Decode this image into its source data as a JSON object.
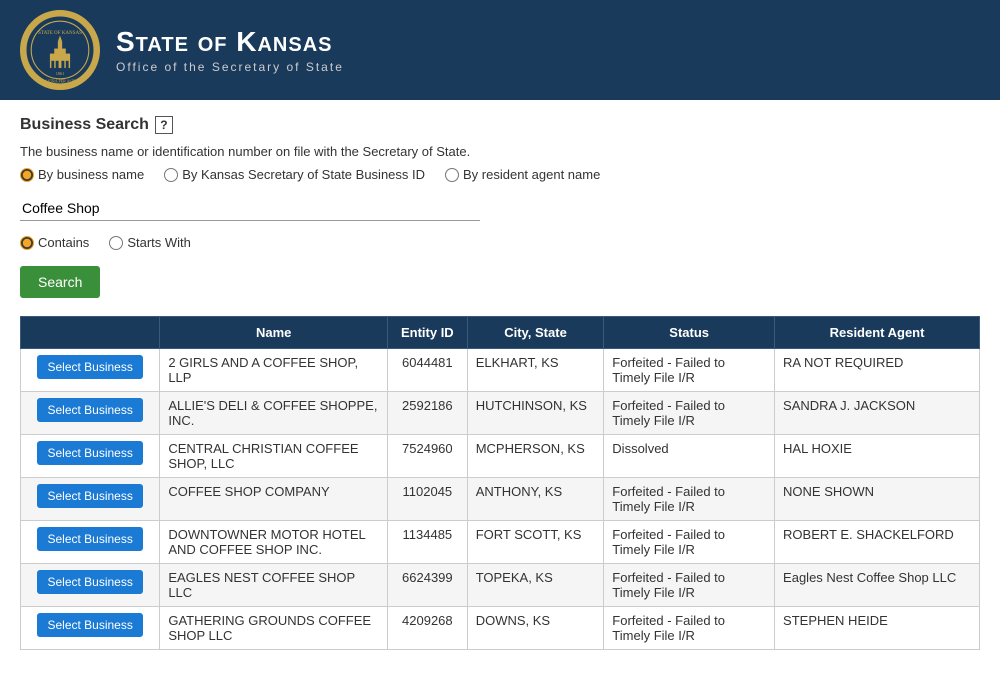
{
  "header": {
    "title": "State of Kansas",
    "subtitle": "Office of the Secretary of State"
  },
  "page": {
    "section_title": "Business Search",
    "help_label": "?",
    "description": "The business name or identification number on file with the Secretary of State.",
    "search_options": [
      {
        "id": "by-name",
        "label": "By business name",
        "checked": true
      },
      {
        "id": "by-id",
        "label": "By Kansas Secretary of State Business ID",
        "checked": false
      },
      {
        "id": "by-agent",
        "label": "By resident agent name",
        "checked": false
      }
    ],
    "search_input_value": "Coffee Shop",
    "search_input_placeholder": "",
    "match_options": [
      {
        "id": "contains",
        "label": "Contains",
        "checked": true
      },
      {
        "id": "starts-with",
        "label": "Starts With",
        "checked": false
      }
    ],
    "search_button_label": "Search",
    "table": {
      "columns": [
        "",
        "Name",
        "Entity ID",
        "City, State",
        "Status",
        "Resident Agent"
      ],
      "rows": [
        {
          "select_label": "Select Business",
          "name": "2 GIRLS AND A COFFEE SHOP, LLP",
          "entity_id": "6044481",
          "city_state": "ELKHART, KS",
          "status": "Forfeited - Failed to Timely File I/R",
          "agent": "RA NOT REQUIRED"
        },
        {
          "select_label": "Select Business",
          "name": "ALLIE'S DELI & COFFEE SHOPPE, INC.",
          "entity_id": "2592186",
          "city_state": "HUTCHINSON, KS",
          "status": "Forfeited - Failed to Timely File I/R",
          "agent": "SANDRA J. JACKSON"
        },
        {
          "select_label": "Select Business",
          "name": "CENTRAL CHRISTIAN COFFEE SHOP, LLC",
          "entity_id": "7524960",
          "city_state": "MCPHERSON, KS",
          "status": "Dissolved",
          "agent": "HAL HOXIE"
        },
        {
          "select_label": "Select Business",
          "name": "COFFEE SHOP COMPANY",
          "entity_id": "1102045",
          "city_state": "ANTHONY, KS",
          "status": "Forfeited - Failed to Timely File I/R",
          "agent": "NONE SHOWN"
        },
        {
          "select_label": "Select Business",
          "name": "DOWNTOWNER MOTOR HOTEL AND COFFEE SHOP INC.",
          "entity_id": "1134485",
          "city_state": "FORT SCOTT, KS",
          "status": "Forfeited - Failed to Timely File I/R",
          "agent": "ROBERT E. SHACKELFORD"
        },
        {
          "select_label": "Select Business",
          "name": "EAGLES NEST COFFEE SHOP LLC",
          "entity_id": "6624399",
          "city_state": "TOPEKA, KS",
          "status": "Forfeited - Failed to Timely File I/R",
          "agent": "Eagles Nest Coffee Shop LLC"
        },
        {
          "select_label": "Select Business",
          "name": "GATHERING GROUNDS COFFEE SHOP LLC",
          "entity_id": "4209268",
          "city_state": "DOWNS, KS",
          "status": "Forfeited - Failed to Timely File I/R",
          "agent": "STEPHEN HEIDE"
        }
      ]
    }
  }
}
